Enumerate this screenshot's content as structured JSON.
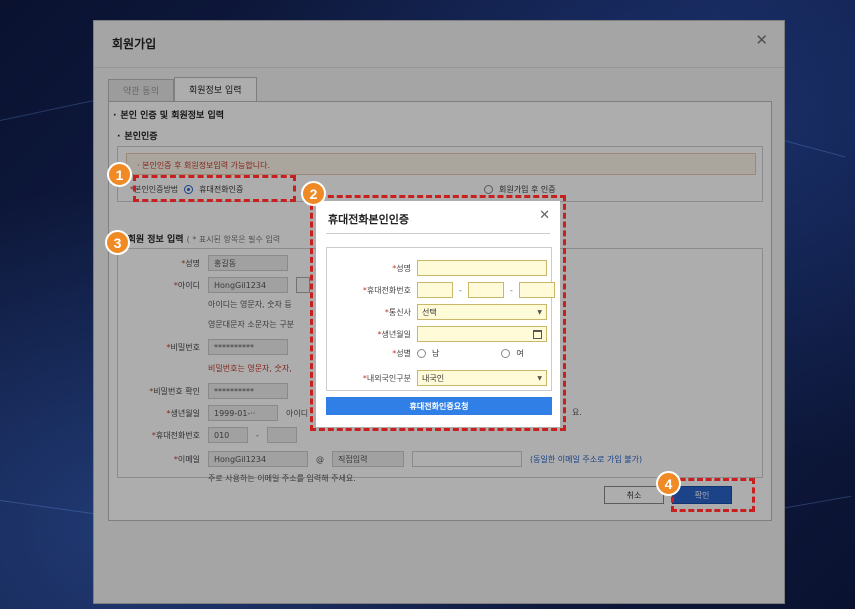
{
  "window": {
    "title": "회원가입",
    "close_icon": "✕",
    "tabs": [
      "약관 동의",
      "회원정보 입력"
    ]
  },
  "sections": {
    "main_heading": "본인 인증 및 회원정보 입력",
    "auth_heading": "본인인증",
    "notice": "본인인증 후 회원정보입력 가능합니다.",
    "auth_method_label": "본인인증방법",
    "auth_option_phone": "휴대전화인증",
    "auth_option_after": "회원가입 후 인증",
    "member_heading": "회원 정보 입력",
    "member_heading_note": "( * 표시된 항목은 필수 입력"
  },
  "form": {
    "name_label": "성명",
    "name_value": "홍길동",
    "id_label": "아이디",
    "id_value": "HongGil1234",
    "id_help_1": "아이디는 영문자, 숫자 등",
    "id_help_2": "영문대문자 소문자는 구분",
    "password_label": "비밀번호",
    "password_value": "**********",
    "password_help": "비밀번호는 영문자, 숫자,",
    "password_confirm_label": "비밀번호 확인",
    "password_confirm_value": "**********",
    "birth_label": "생년월일",
    "birth_value": "1999-01-··",
    "birth_help": "아이디",
    "birth_help_tail": "요.",
    "phone_label": "휴대전화번호",
    "phone_prefix": "010",
    "email_label": "이메일",
    "email_value": "HongGil1234",
    "email_at": "@",
    "email_domain": "직접입력",
    "email_link": "(동일한 이메일 주소로 가입 불가)",
    "email_help": "주로 사용하는 이메일 주소를 입력해 주세요."
  },
  "footer": {
    "cancel_label": "취소",
    "ok_label": "확인"
  },
  "modal": {
    "title": "휴대전화본인인증",
    "close_icon": "✕",
    "name_label": "성명",
    "phone_label": "휴대전화번호",
    "carrier_label": "통신사",
    "carrier_value": "선택",
    "birth_label": "생년월일",
    "gender_label": "성별",
    "gender_male": "남",
    "gender_female": "여",
    "nationality_label": "내외국인구분",
    "nationality_value": "내국인",
    "submit_label": "휴대전화인증요청"
  },
  "badges": [
    "1",
    "2",
    "3",
    "4"
  ],
  "colors": {
    "highlight": "#c81f1f",
    "badge": "#f08a25",
    "primary": "#2a62c9",
    "modal_button": "#2f7fe6"
  }
}
